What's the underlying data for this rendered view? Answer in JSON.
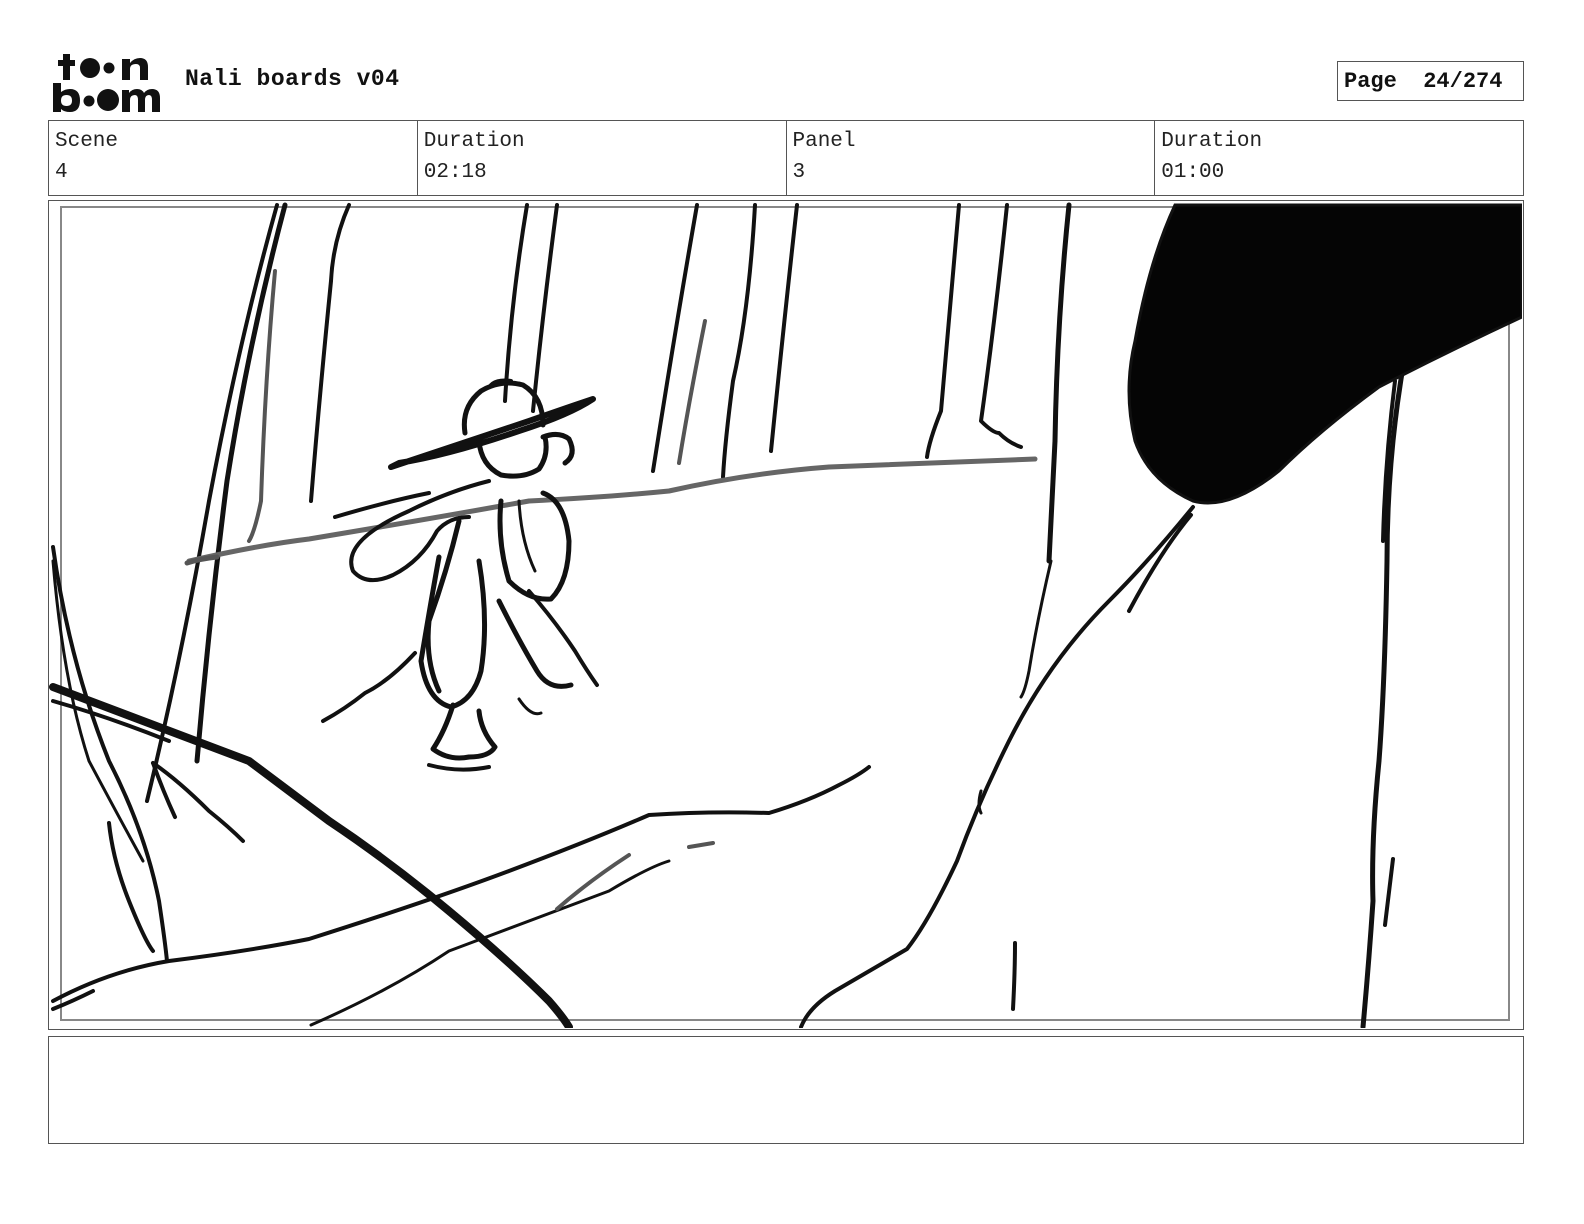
{
  "header": {
    "logo_text": "toonboom",
    "title": "Nali boards v04",
    "page_label": "Page",
    "page_value": "24/274"
  },
  "info": {
    "scene_label": "Scene",
    "scene_value": "4",
    "scene_duration_label": "Duration",
    "scene_duration_value": "02:18",
    "panel_label": "Panel",
    "panel_value": "3",
    "panel_duration_label": "Duration",
    "panel_duration_value": "01:00"
  },
  "notes": {
    "text": ""
  }
}
